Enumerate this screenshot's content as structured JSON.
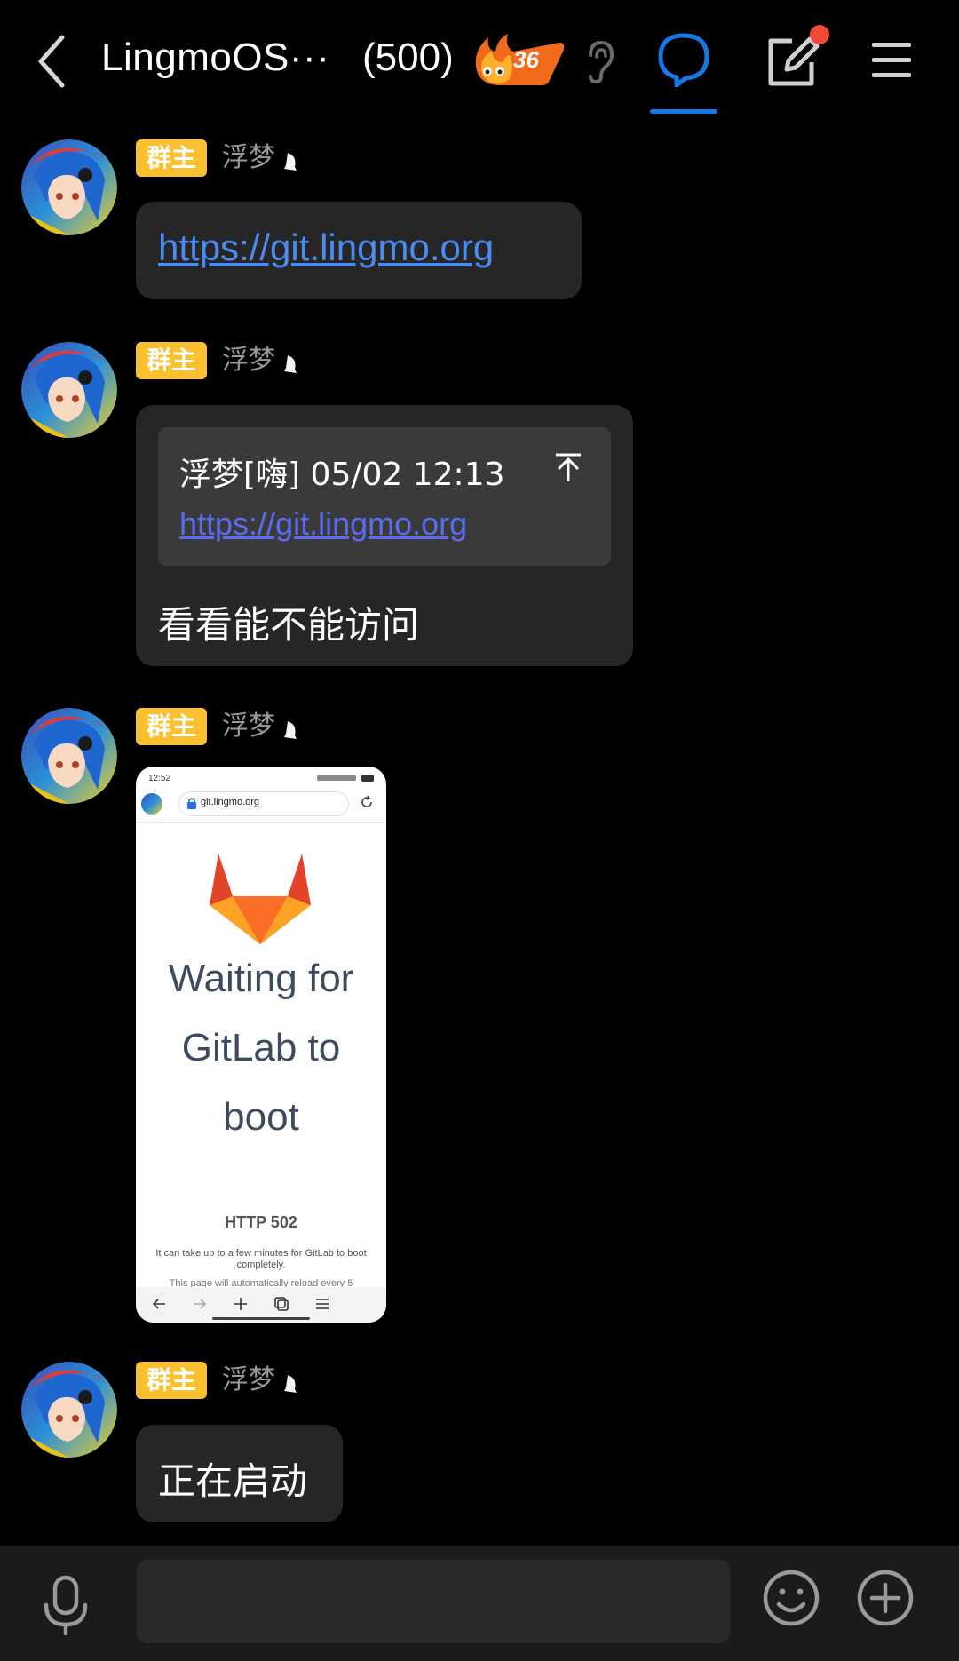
{
  "header": {
    "title": "LingmoOS···",
    "member_count": "(500)",
    "fire_level": "36",
    "icons": [
      "back-arrow-icon",
      "fire-icon",
      "ear-icon",
      "chat-bubble-icon",
      "edit-icon",
      "menu-icon"
    ]
  },
  "messages": [
    {
      "badge": "群主",
      "sender": "浮梦",
      "link": "https://git.lingmo.org"
    },
    {
      "badge": "群主",
      "sender": "浮梦",
      "quote_header": "浮梦[嗨] 05/02 12:13",
      "quote_link": "https://git.lingmo.org",
      "text": "看看能不能访问"
    },
    {
      "badge": "群主",
      "sender": "浮梦",
      "image": {
        "time": "12:52",
        "url": "git.lingmo.org",
        "heading": [
          "Waiting for",
          "GitLab to",
          "boot"
        ],
        "status": "HTTP 502",
        "desc": "It can take up to a few minutes for GitLab to boot completely.",
        "desc2": "This page will automatically reload every 5"
      }
    },
    {
      "badge": "群主",
      "sender": "浮梦",
      "text": "正在启动"
    }
  ],
  "colors": {
    "accent": "#1677e6",
    "badge": "#fbc02d",
    "link": "#4a8cf2",
    "notification": "#f04b3a"
  },
  "bottom_bar": {
    "icons": [
      "mic-icon",
      "emoji-icon",
      "plus-icon"
    ]
  }
}
